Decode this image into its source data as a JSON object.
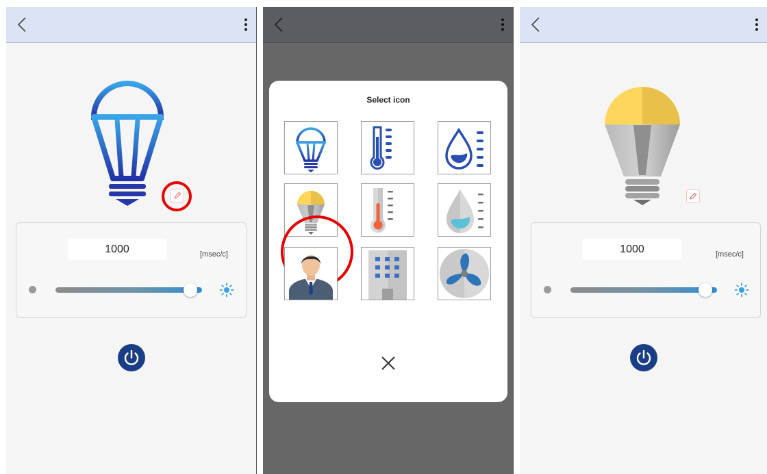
{
  "screens": [
    {
      "id": "before",
      "device_name": {
        "value": "1000",
        "unit": "[msec/c]"
      },
      "slider_value_percent": 92,
      "icon": "blue-bulb-icon"
    },
    {
      "id": "picker",
      "dialog": {
        "title": "Select icon",
        "icons": [
          "blue-bulb-icon",
          "blue-thermometer-icon",
          "blue-humidity-icon",
          "yellow-bulb-icon",
          "gray-thermometer-icon",
          "gray-humidity-icon",
          "person-icon",
          "building-icon",
          "fan-icon"
        ],
        "highlighted_icon": "yellow-bulb-icon",
        "close_icon": "close-icon"
      }
    },
    {
      "id": "after",
      "device_name": {
        "value": "1000",
        "unit": "[msec/c]"
      },
      "slider_value_percent": 92,
      "icon": "yellow-bulb-icon"
    }
  ],
  "colors": {
    "appbar": "#dbe4f4",
    "appbar_dimmed": "#5a5d62",
    "power_button": "#1a3e86",
    "annotation": "#e60000",
    "bulb_yellow": "#fdd65b",
    "bulb_gradient_top": "#3aa4e8",
    "bulb_gradient_bottom": "#2233a8"
  }
}
